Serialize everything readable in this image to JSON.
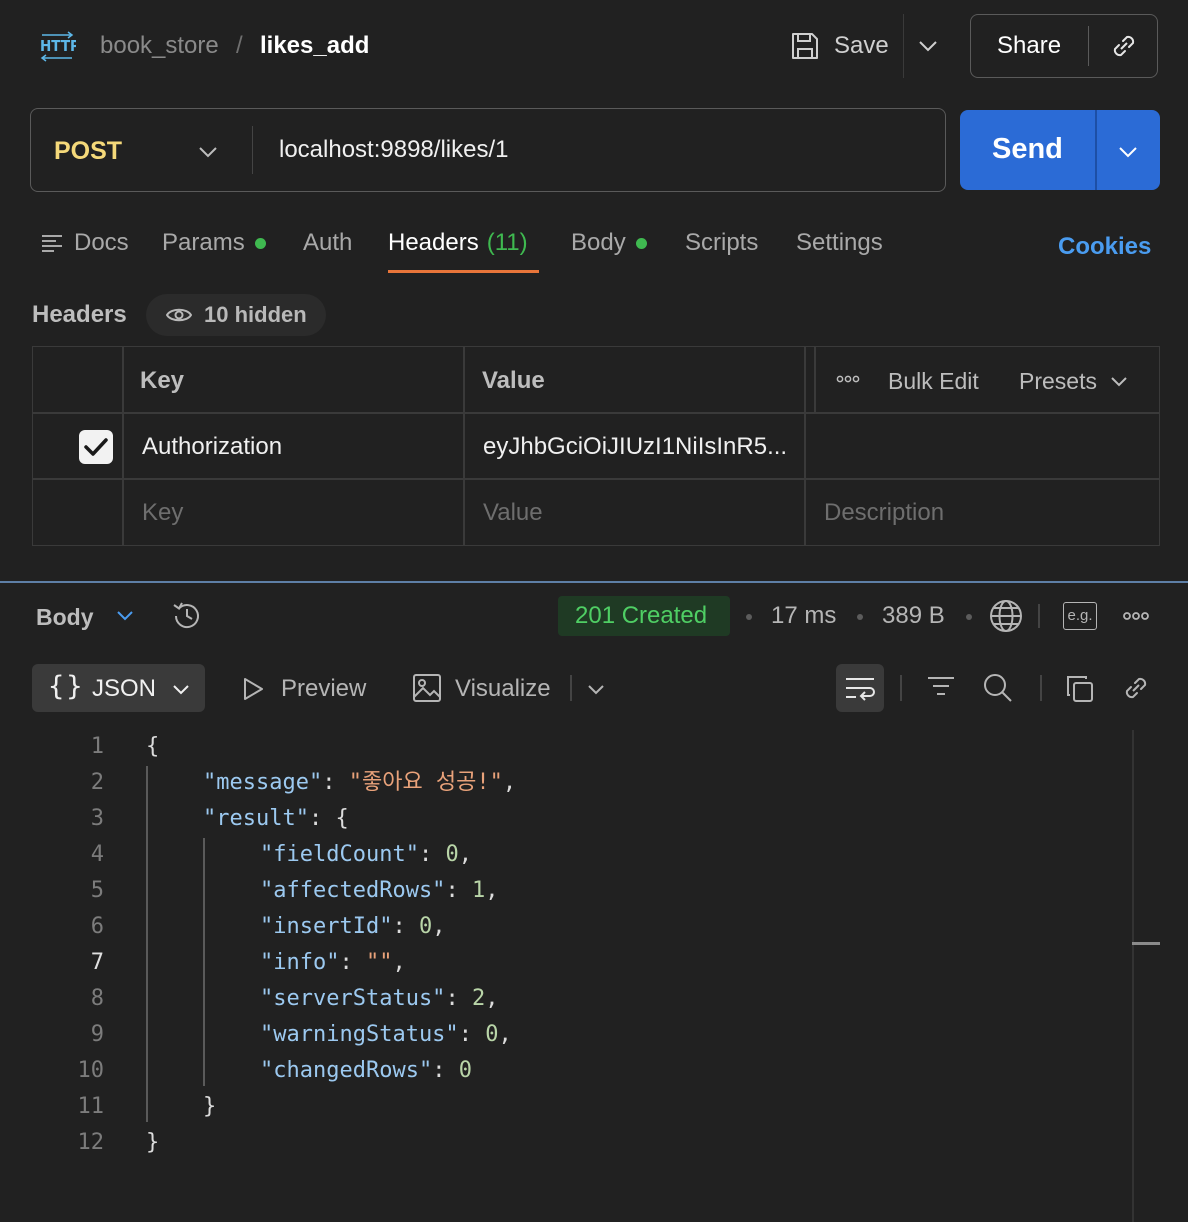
{
  "breadcrumb": {
    "icon": "http-icon",
    "parent": "book_store",
    "separator": "/",
    "name": "likes_add"
  },
  "toolbar": {
    "save_label": "Save",
    "share_label": "Share"
  },
  "request": {
    "method": "POST",
    "url": "localhost:9898/likes/1",
    "send_label": "Send"
  },
  "tabs": [
    {
      "label": "Docs"
    },
    {
      "label": "Params",
      "dot": true
    },
    {
      "label": "Auth"
    },
    {
      "label": "Headers",
      "count": "(11)",
      "active": true
    },
    {
      "label": "Body",
      "dot": true
    },
    {
      "label": "Scripts"
    },
    {
      "label": "Settings"
    }
  ],
  "cookies_label": "Cookies",
  "headers_section": {
    "title": "Headers",
    "hidden": "10 hidden",
    "columns": {
      "key": "Key",
      "value": "Value",
      "bulk_edit": "Bulk Edit",
      "presets": "Presets"
    },
    "rows": [
      {
        "checked": true,
        "key": "Authorization",
        "value": "eyJhbGciOiJIUzI1NiIsInR5..."
      }
    ],
    "placeholder": {
      "key": "Key",
      "value": "Value",
      "description": "Description"
    }
  },
  "response": {
    "body_label": "Body",
    "status": "201 Created",
    "time": "17 ms",
    "size": "389 B",
    "example_label": "e.g.",
    "colors": {
      "status_text": "#4fce64",
      "accent": "#2b6bd6",
      "tab_underline": "#e8753a"
    }
  },
  "format_bar": {
    "braces": "{}",
    "format": "JSON",
    "preview": "Preview",
    "visualize": "Visualize"
  },
  "code_lines": [
    {
      "num": "1"
    },
    {
      "num": "2"
    },
    {
      "num": "3"
    },
    {
      "num": "4"
    },
    {
      "num": "5"
    },
    {
      "num": "6"
    },
    {
      "num": "7"
    },
    {
      "num": "8"
    },
    {
      "num": "9"
    },
    {
      "num": "10"
    },
    {
      "num": "11"
    },
    {
      "num": "12"
    }
  ],
  "json": {
    "open": "{",
    "close": "}",
    "message_key": "\"message\"",
    "message_value": "\"좋아요 성공!\"",
    "result_key": "\"result\"",
    "fieldCount_key": "\"fieldCount\"",
    "fieldCount_value": "0",
    "affectedRows_key": "\"affectedRows\"",
    "affectedRows_value": "1",
    "insertId_key": "\"insertId\"",
    "insertId_value": "0",
    "info_key": "\"info\"",
    "info_value": "\"\"",
    "serverStatus_key": "\"serverStatus\"",
    "serverStatus_value": "2",
    "warningStatus_key": "\"warningStatus\"",
    "warningStatus_value": "0",
    "changedRows_key": "\"changedRows\"",
    "changedRows_value": "0"
  }
}
